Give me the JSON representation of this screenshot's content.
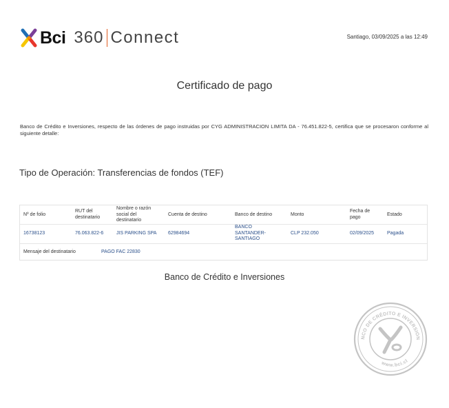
{
  "header": {
    "logo_brand": "Bci",
    "logo_product_number": "360",
    "logo_product_name": "Connect",
    "date_text": "Santiago, 03/09/2025 a las 12:49"
  },
  "document": {
    "title": "Certificado de pago",
    "intro": "Banco de Crédito e Inversiones, respecto de las órdenes de pago instruidas por CYG ADMINISTRACION LIMITA DA - 76.451.822-5, certifica que se procesaron conforme al siguiente detalle:",
    "operation_type": "Tipo de Operación: Transferencias de fondos (TEF)"
  },
  "table": {
    "headers": {
      "folio": "Nº de folio",
      "rut": "RUT del destinatario",
      "name": "Nombre o razón social del destinatario",
      "account": "Cuenta de destino",
      "bank": "Banco de destino",
      "amount": "Monto",
      "date": "Fecha de pago",
      "status": "Estado"
    },
    "row": {
      "folio": "16738123",
      "rut": "76.063.822-6",
      "name": "JIS PARKING SPA",
      "account": "62984694",
      "bank": "BANCO SANTANDER-SANTIAGO",
      "amount": "CLP 232.050",
      "date": "02/09/2025",
      "status": "Pagada"
    },
    "message_label": "Mensaje del destinatario",
    "message_value": "PAGO FAC 22830"
  },
  "footer": {
    "bank_name": "Banco de Crédito e Inversiones"
  },
  "seal": {
    "ring_text": "BANCO DE CRÉDITO E INVERSIONES",
    "url_text": "www.bci.cl"
  },
  "colors": {
    "value_blue": "#2a4f8a",
    "seal_gray": "#c4c4c4",
    "logo_red": "#e8372c",
    "logo_orange": "#f39200",
    "logo_yellow": "#f6c600",
    "logo_purple": "#7b3f98",
    "logo_blue": "#1f6fb5"
  }
}
